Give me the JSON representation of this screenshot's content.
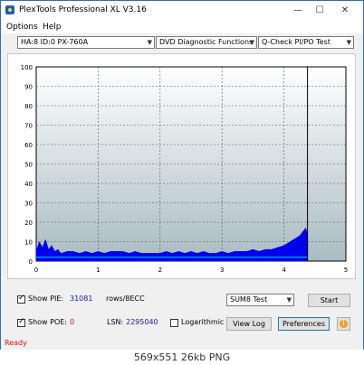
{
  "window": {
    "title": "PlexTools Professional XL V3.16",
    "minimize": "—",
    "maximize": "☐",
    "close": "✕"
  },
  "menu": {
    "options": "Options",
    "help": "Help"
  },
  "toolbar": {
    "drive": "HA:8 ID:0  PX-760A",
    "function": "DVD Diagnostic Functions",
    "test": "Q-Check PI/PO Test"
  },
  "chart_data": {
    "type": "area",
    "xlim": [
      0,
      5
    ],
    "ylim": [
      0,
      100
    ],
    "x_ticks": [
      0,
      1,
      2,
      3,
      4,
      5
    ],
    "y_ticks": [
      0,
      10,
      20,
      30,
      40,
      50,
      60,
      70,
      80,
      90,
      100
    ],
    "grid": true,
    "background_gradient": [
      "#ffffff",
      "#a9bcc2"
    ],
    "marker_x": 4.38,
    "series": [
      {
        "color": "#0000ee",
        "points": [
          [
            0.0,
            5
          ],
          [
            0.05,
            10
          ],
          [
            0.1,
            7
          ],
          [
            0.15,
            11
          ],
          [
            0.2,
            6
          ],
          [
            0.25,
            8
          ],
          [
            0.3,
            5
          ],
          [
            0.35,
            6
          ],
          [
            0.4,
            4
          ],
          [
            0.5,
            5
          ],
          [
            0.6,
            5
          ],
          [
            0.7,
            4
          ],
          [
            0.8,
            5
          ],
          [
            0.9,
            4
          ],
          [
            1.0,
            5
          ],
          [
            1.1,
            4
          ],
          [
            1.2,
            5
          ],
          [
            1.3,
            5
          ],
          [
            1.4,
            5
          ],
          [
            1.5,
            4
          ],
          [
            1.6,
            5
          ],
          [
            1.7,
            4
          ],
          [
            1.8,
            4
          ],
          [
            1.9,
            4
          ],
          [
            2.0,
            4
          ],
          [
            2.1,
            5
          ],
          [
            2.2,
            4
          ],
          [
            2.3,
            5
          ],
          [
            2.4,
            4
          ],
          [
            2.5,
            5
          ],
          [
            2.6,
            4
          ],
          [
            2.7,
            5
          ],
          [
            2.8,
            4
          ],
          [
            2.9,
            4
          ],
          [
            3.0,
            5
          ],
          [
            3.1,
            4
          ],
          [
            3.2,
            5
          ],
          [
            3.3,
            5
          ],
          [
            3.4,
            5
          ],
          [
            3.5,
            6
          ],
          [
            3.6,
            5
          ],
          [
            3.7,
            6
          ],
          [
            3.8,
            6
          ],
          [
            3.9,
            7
          ],
          [
            4.0,
            8
          ],
          [
            4.05,
            9
          ],
          [
            4.1,
            10
          ],
          [
            4.15,
            11
          ],
          [
            4.2,
            12
          ],
          [
            4.25,
            13
          ],
          [
            4.3,
            15
          ],
          [
            4.35,
            17
          ],
          [
            4.38,
            14
          ]
        ]
      },
      {
        "color": "#00c8c8",
        "points": [
          [
            0.0,
            2
          ],
          [
            1.0,
            2
          ],
          [
            2.0,
            2
          ],
          [
            3.0,
            2
          ],
          [
            4.0,
            2
          ],
          [
            4.38,
            2
          ]
        ]
      }
    ]
  },
  "controls": {
    "show_pie_label": "Show PIE:",
    "pie_value": "31081",
    "rows_label": "rows/8ECC",
    "show_poe_label": "Show POE:",
    "poe_value": "0",
    "lsn_label": "LSN:",
    "lsn_value": "2295040",
    "logarithmic_label": "Logarithmic",
    "sum_mode": "SUM8 Test",
    "start_label": "Start",
    "view_log_label": "View Log",
    "preferences_label": "Preferences",
    "info_symbol": "i"
  },
  "status": {
    "text": "Ready"
  },
  "caption": {
    "text": "569x551  26kb  PNG"
  }
}
